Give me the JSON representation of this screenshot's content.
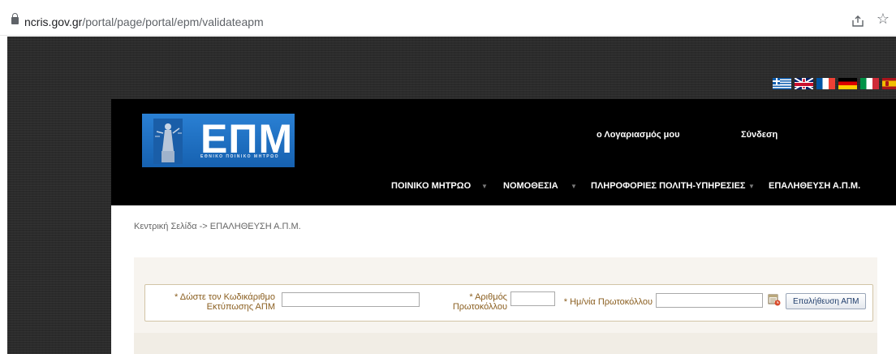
{
  "browser": {
    "url_host": "ncris.gov.gr",
    "url_path": "/portal/page/portal/epm/validateapm"
  },
  "languages": [
    {
      "code": "gr",
      "name": "greek-flag"
    },
    {
      "code": "uk",
      "name": "uk-flag"
    },
    {
      "code": "fr",
      "name": "french-flag"
    },
    {
      "code": "de",
      "name": "german-flag"
    },
    {
      "code": "it",
      "name": "italian-flag"
    },
    {
      "code": "es",
      "name": "spanish-flag"
    }
  ],
  "logo": {
    "title": "ΕΠΜ",
    "subtitle": "ΕΘΝΙΚΟ ΠΟΙΝΙΚΟ ΜΗΤΡΩΟ"
  },
  "header": {
    "account": "ο Λογαριασμός μου",
    "login": "Σύνδεση"
  },
  "nav": [
    {
      "label": "ΠΟΙΝΙΚΟ ΜΗΤΡΩΟ"
    },
    {
      "label": "ΝΟΜΟΘΕΣΙΑ"
    },
    {
      "label": "ΠΛΗΡΟΦΟΡΙΕΣ ΠΟΛΙΤΗ-ΥΠΗΡΕΣΙΕΣ"
    },
    {
      "label": "ΕΠΑΛΗΘΕΥΣΗ Α.Π.Μ."
    }
  ],
  "breadcrumb": "Κεντρική Σελίδα -> ΕΠΑΛΗΘΕΥΣΗ Α.Π.Μ.",
  "form": {
    "code_label_line1": "* Δώστε τον Κωδικάριθμο",
    "code_label_line2": "Εκτύπωσης ΑΠΜ",
    "code_value": "",
    "protocol_label_line1": "* Αριθμός",
    "protocol_label_line2": "Πρωτοκόλλου",
    "protocol_value": "",
    "date_label": "* Ημ/νία Πρωτοκόλλου",
    "date_value": "",
    "submit_label": "Επαλήθευση ΑΠΜ"
  }
}
